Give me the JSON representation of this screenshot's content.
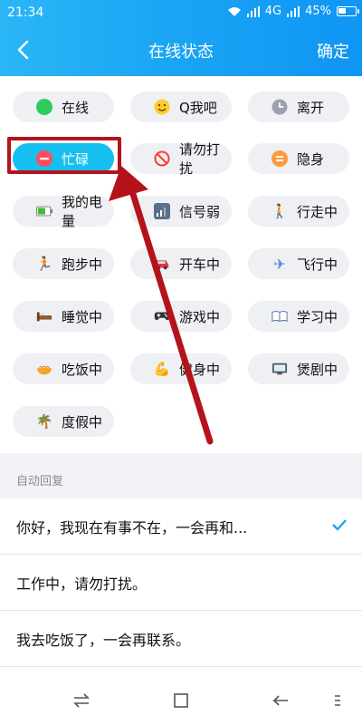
{
  "statusbar": {
    "time": "21:34",
    "network": "4G",
    "battery": "45%",
    "battery_level": 0.45
  },
  "header": {
    "title": "在线状态",
    "confirm_label": "确定"
  },
  "chips": [
    {
      "label": "在线",
      "icon": "green-dot-icon",
      "color": "#2dcc5a"
    },
    {
      "label": "Q我吧",
      "icon": "smile-emoji-icon"
    },
    {
      "label": "离开",
      "icon": "clock-icon"
    },
    {
      "label": "忙碌",
      "icon": "minus-circle-icon",
      "color": "#ff4d5e",
      "selected": true
    },
    {
      "label": "请勿打扰",
      "icon": "no-entry-icon",
      "color": "#ff3b30"
    },
    {
      "label": "隐身",
      "icon": "equals-circle-icon",
      "color": "#ff9a3c"
    },
    {
      "label": "我的电量",
      "icon": "battery-icon"
    },
    {
      "label": "信号弱",
      "icon": "signal-weak-icon"
    },
    {
      "label": "行走中",
      "icon": "walking-icon"
    },
    {
      "label": "跑步中",
      "icon": "running-icon"
    },
    {
      "label": "开车中",
      "icon": "car-icon"
    },
    {
      "label": "飞行中",
      "icon": "airplane-icon"
    },
    {
      "label": "睡觉中",
      "icon": "bed-icon"
    },
    {
      "label": "游戏中",
      "icon": "gamepad-icon"
    },
    {
      "label": "学习中",
      "icon": "book-icon"
    },
    {
      "label": "吃饭中",
      "icon": "noodle-bowl-icon"
    },
    {
      "label": "健身中",
      "icon": "biceps-icon"
    },
    {
      "label": "煲剧中",
      "icon": "tv-icon"
    },
    {
      "label": "度假中",
      "icon": "palm-tree-icon"
    }
  ],
  "auto_reply": {
    "section_label": "自动回复",
    "items": [
      {
        "text": "你好，我现在有事不在，一会再和...",
        "checked": true
      },
      {
        "text": "工作中，请勿打扰。",
        "checked": false
      },
      {
        "text": "我去吃饭了，一会再联系。",
        "checked": false
      }
    ]
  },
  "colors": {
    "accent": "#16bff0",
    "check": "#1aa6f4",
    "annotation": "#b5121b"
  }
}
